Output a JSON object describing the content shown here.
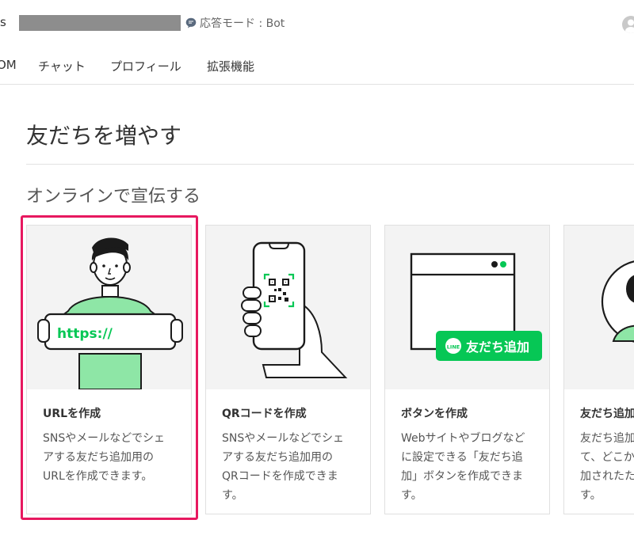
{
  "header": {
    "account_suffix": "s",
    "mode_label": "応答モード : Bot"
  },
  "nav": {
    "items": [
      {
        "label": "OM"
      },
      {
        "label": "チャット"
      },
      {
        "label": "プロフィール"
      },
      {
        "label": "拡張機能"
      }
    ]
  },
  "page": {
    "title": "友だちを増やす",
    "section_heading": "オンラインで宣伝する"
  },
  "cards": [
    {
      "title": "URLを作成",
      "desc_lines": [
        "SNSやメールなどでシェ",
        "アする友だち追加用の",
        "URLを作成できます。"
      ],
      "image_text": "https://"
    },
    {
      "title": "QRコードを作成",
      "desc_lines": [
        "SNSやメールなどでシェ",
        "アする友だち追加用の",
        "QRコードを作成できま",
        "す。"
      ]
    },
    {
      "title": "ボタンを作成",
      "desc_lines": [
        "Webサイトやブログなど",
        "に設定できる「友だち追",
        "加」ボタンを作成できま",
        "す。"
      ],
      "badge_text": "友だち追加",
      "badge_icon_text": "LINE"
    },
    {
      "title": "友だち追加",
      "desc_lines": [
        "友だち追加",
        "て、どこか",
        "加されたた",
        "す。"
      ]
    }
  ],
  "colors": {
    "highlight": "#e7185f",
    "line_green": "#06c755",
    "illustration_green": "#8ee6a6"
  }
}
